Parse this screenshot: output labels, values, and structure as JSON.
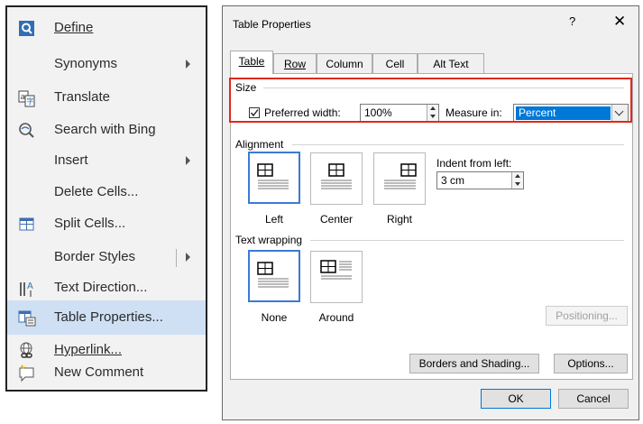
{
  "context_menu": {
    "items": [
      {
        "label": "Define",
        "icon": "define-icon",
        "submenu": false
      },
      {
        "label": "Synonyms",
        "icon": "",
        "submenu": true
      },
      {
        "label": "Translate",
        "icon": "translate-icon",
        "submenu": false
      },
      {
        "label": "Search with Bing",
        "icon": "search-icon",
        "submenu": false
      },
      {
        "label": "Insert",
        "icon": "",
        "submenu": true
      },
      {
        "label": "Delete Cells...",
        "icon": "",
        "submenu": false
      },
      {
        "label": "Split Cells...",
        "icon": "split-cells-icon",
        "submenu": false
      },
      {
        "label": "Border Styles",
        "icon": "",
        "submenu": true
      },
      {
        "label": "Text Direction...",
        "icon": "text-direction-icon",
        "submenu": false
      },
      {
        "label": "Table Properties...",
        "icon": "table-properties-icon",
        "submenu": false,
        "highlighted": true
      },
      {
        "label": "Hyperlink...",
        "icon": "hyperlink-icon",
        "submenu": false
      },
      {
        "label": "New Comment",
        "icon": "new-comment-icon",
        "submenu": false
      }
    ]
  },
  "dialog": {
    "title": "Table Properties",
    "help": "?",
    "close": "✕",
    "tabs": [
      "Table",
      "Row",
      "Column",
      "Cell",
      "Alt Text"
    ],
    "active_tab": "Table",
    "size": {
      "group_label": "Size",
      "preferred_width_label": "Preferred width:",
      "preferred_width_checked": true,
      "preferred_width_value": "100%",
      "measure_in_label": "Measure in:",
      "measure_in_value": "Percent"
    },
    "alignment": {
      "group_label": "Alignment",
      "options": [
        "Left",
        "Center",
        "Right"
      ],
      "selected": "Left",
      "indent_label": "Indent from left:",
      "indent_value": "3 cm"
    },
    "text_wrapping": {
      "group_label": "Text wrapping",
      "options": [
        "None",
        "Around"
      ],
      "selected": "None",
      "positioning_button": "Positioning..."
    },
    "borders_button": "Borders and Shading...",
    "options_button": "Options...",
    "ok_button": "OK",
    "cancel_button": "Cancel"
  },
  "colors": {
    "highlight_red": "#e0281c",
    "selection_blue": "#0078d7",
    "menu_highlight": "#cfe0f5"
  }
}
